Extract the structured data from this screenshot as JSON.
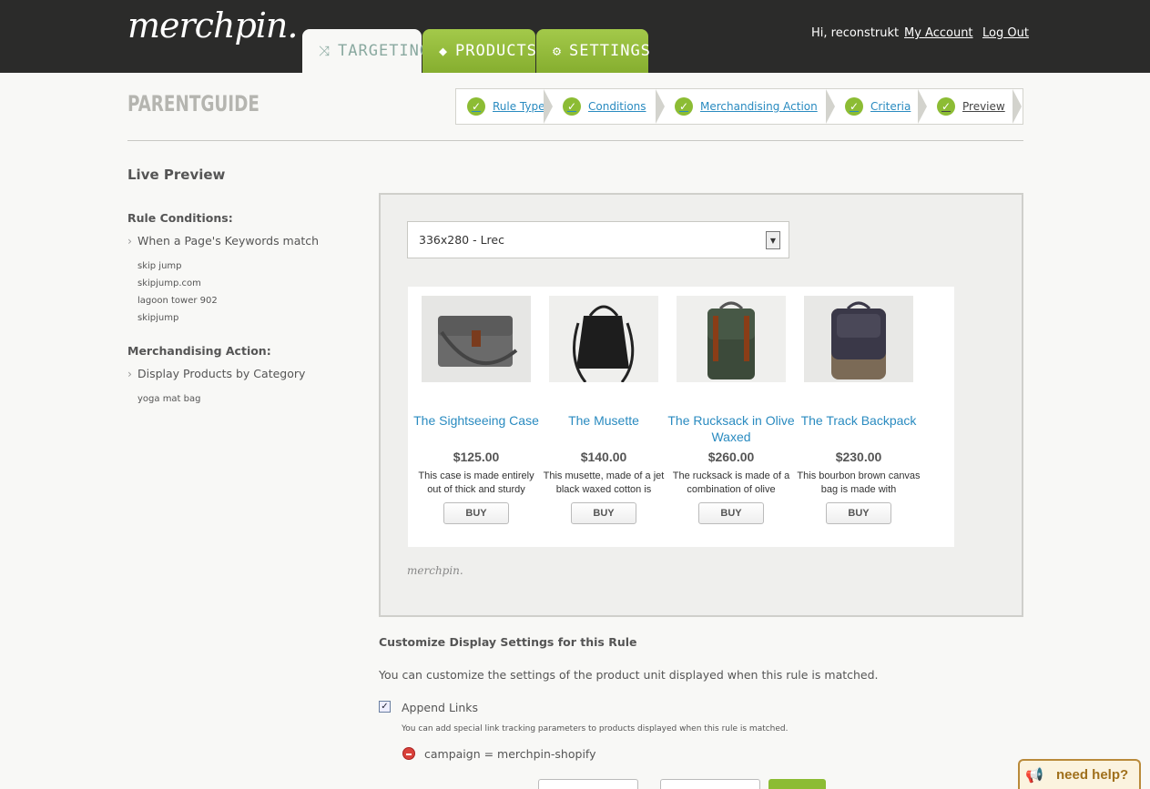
{
  "app": {
    "logo": "merchpin."
  },
  "tabs": [
    {
      "label": "TARGETING",
      "icon": "shuffle-icon"
    },
    {
      "label": "PRODUCTS",
      "icon": "tag-icon"
    },
    {
      "label": "SETTINGS",
      "icon": "gear-icon"
    }
  ],
  "user": {
    "greeting": "Hi, reconstrukt",
    "my_account": "My Account",
    "log_out": "Log Out"
  },
  "page": {
    "title": "PARENTGUIDE"
  },
  "steps": [
    "Rule Type",
    "Conditions",
    "Merchandising Action",
    "Criteria",
    "Preview"
  ],
  "sidebar": {
    "heading": "Live Preview",
    "conditions_title": "Rule Conditions:",
    "conditions_item": "When a Page's Keywords match",
    "keywords": [
      "skip jump",
      "skipjump.com",
      "lagoon tower 902",
      "skipjump"
    ],
    "action_title": "Merchandising Action:",
    "action_item": "Display Products by Category",
    "category": "yoga mat bag"
  },
  "preview": {
    "size_select": "336x280 - Lrec",
    "brand_mark": "merchpin.",
    "products": [
      {
        "name": "The Sightseeing Case",
        "price": "$125.00",
        "desc": "This case is made entirely out of thick and sturdy",
        "buy": "BUY"
      },
      {
        "name": "The Musette",
        "price": "$140.00",
        "desc": "This musette, made of a jet black waxed cotton is",
        "buy": "BUY"
      },
      {
        "name": "The Rucksack in Olive Waxed",
        "price": "$260.00",
        "desc": "The rucksack is made of a combination of olive",
        "buy": "BUY"
      },
      {
        "name": "The Track Backpack",
        "price": "$230.00",
        "desc": "This bourbon brown canvas bag is made with",
        "buy": "BUY"
      }
    ]
  },
  "customize": {
    "title": "Customize Display Settings for this Rule",
    "desc": "You can customize the settings of the product unit displayed when this rule is matched.",
    "append_label": "Append Links",
    "append_checked": true,
    "hint": "You can add special link tracking parameters to products displayed when this rule is matched.",
    "param": "campaign = merchpin-shopify"
  },
  "help": {
    "label": "need help?"
  },
  "colors": {
    "accent_green": "#8cbc34",
    "link_blue": "#2a8bc0",
    "topbar": "#2b2b2a"
  }
}
